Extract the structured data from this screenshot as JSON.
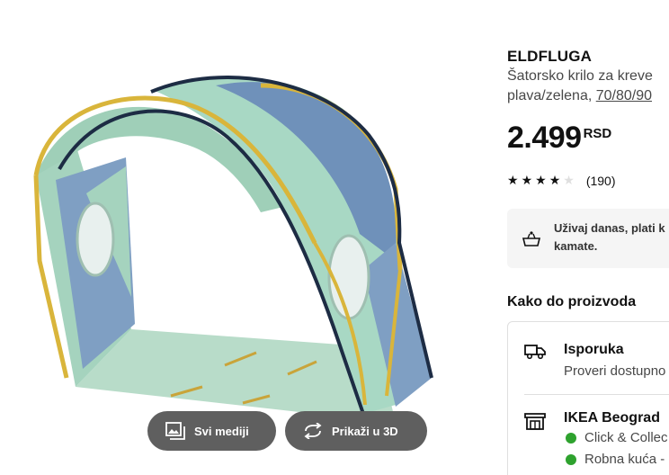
{
  "gallery": {
    "image_alt": "ELDFLUGA",
    "btn_all_media": "Svi mediji",
    "btn_3d": "Prikaži u 3D"
  },
  "product": {
    "name": "ELDFLUGA",
    "desc_line1": "Šatorsko krilo za kreve",
    "desc_line2_prefix": "plava/zelena, ",
    "desc_line2_size": "70/80/90",
    "price_main": "2.499",
    "price_currency": "RSD",
    "rating_value": 4,
    "rating_max": 5,
    "rating_count": "(190)"
  },
  "payment": {
    "line1": "Uživaj danas, plati k",
    "line2": "kamate."
  },
  "availability": {
    "heading": "Kako do proizvoda",
    "delivery_title": "Isporuka",
    "delivery_sub": "Proveri dostupno",
    "store_title": "IKEA Beograd",
    "store_cc": "Click & Collec",
    "store_house": "Robna kuća -",
    "status_color": "#2ea22e"
  },
  "colors": {
    "button_bg": "#5f5f5f",
    "tent_green": "#a8d8c4",
    "tent_blue": "#6f91ba",
    "tent_yellow": "#d9b53b",
    "tent_navy": "#1d2c44"
  }
}
